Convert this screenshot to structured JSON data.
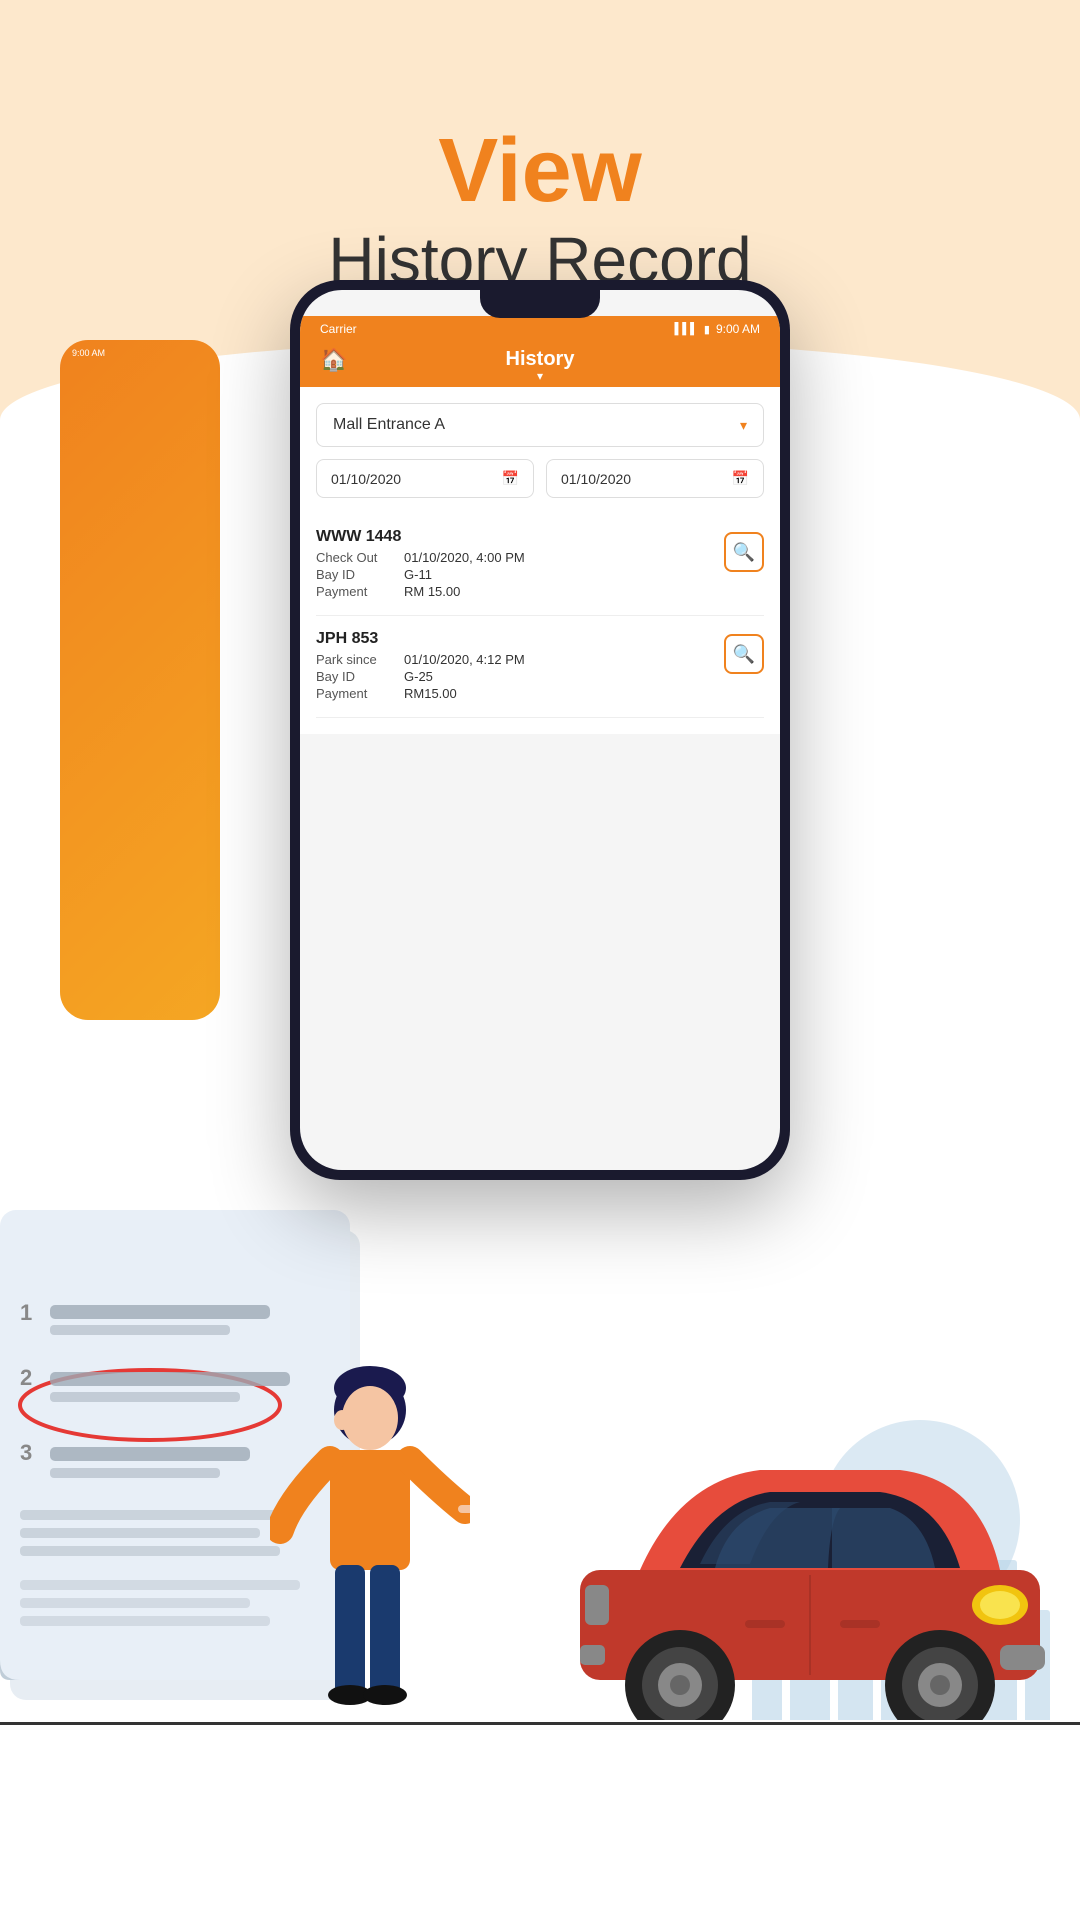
{
  "hero": {
    "view_label": "View",
    "subtitle_label": "History Record"
  },
  "status_bar": {
    "carrier": "Carrier",
    "time": "9:00 AM",
    "signal": "▌▌▌",
    "battery": "▮"
  },
  "app": {
    "title": "History",
    "home_icon": "🏠",
    "arrow_icon": "▾"
  },
  "filter": {
    "location": "Mall Entrance A",
    "date_from": "01/10/2020",
    "date_to": "01/10/2020"
  },
  "records": [
    {
      "plate": "WWW 1448",
      "label1": "Check Out",
      "value1": "01/10/2020, 4:00 PM",
      "label2": "Bay ID",
      "value2": "G-11",
      "label3": "Payment",
      "value3": "RM 15.00"
    },
    {
      "plate": "JPH 853",
      "label1": "Park since",
      "value1": "01/10/2020, 4:12 PM",
      "label2": "Bay ID",
      "value2": "G-25",
      "label3": "Payment",
      "value3": "RM15.00"
    }
  ],
  "colors": {
    "orange": "#f0821e",
    "bg_peach": "#fde8cc",
    "text_dark": "#333333"
  }
}
